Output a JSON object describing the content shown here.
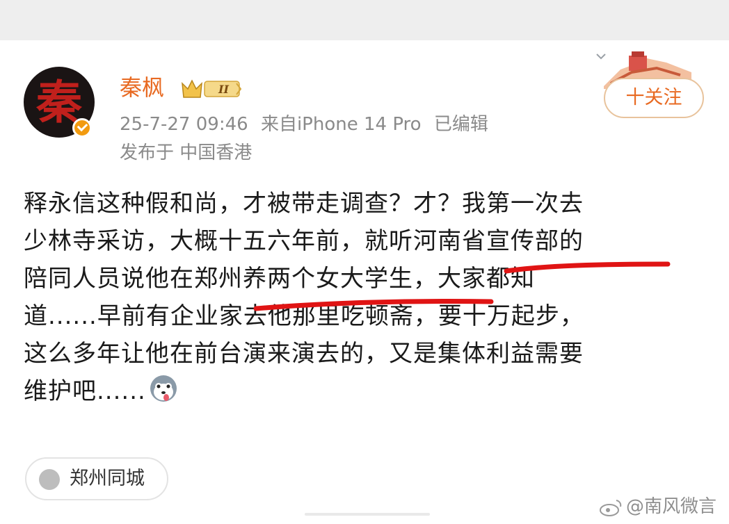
{
  "author": {
    "name": "秦枫",
    "avatar_text": "秦",
    "level_badge": "II",
    "verified": true
  },
  "post_meta": {
    "timestamp": "25-7-27 09:46",
    "source": "来自iPhone 14 Pro",
    "edited": "已编辑",
    "location": "发布于 中国香港"
  },
  "follow_button": {
    "label": "十关注"
  },
  "post": {
    "lines": [
      "释永信这种假和尚，才被带走调查？才？我第一次去",
      "少林寺采访，大概十五六年前，就听河南省宣传部的",
      "陪同人员说他在郑州养两个女大学生，大家都知",
      "道......早前有企业家去他那里吃顿斋，要十万起步，",
      "这么多年让他在前台演来演去的，又是集体利益需要",
      "维护吧......"
    ],
    "emoji": "husky-emoji"
  },
  "location_tag": {
    "label": "郑州同城"
  },
  "watermark": {
    "text": "@南风微言"
  },
  "colors": {
    "accent_orange": "#e86a22",
    "underline_red": "#e01414",
    "meta_gray": "#8a8a8a"
  }
}
